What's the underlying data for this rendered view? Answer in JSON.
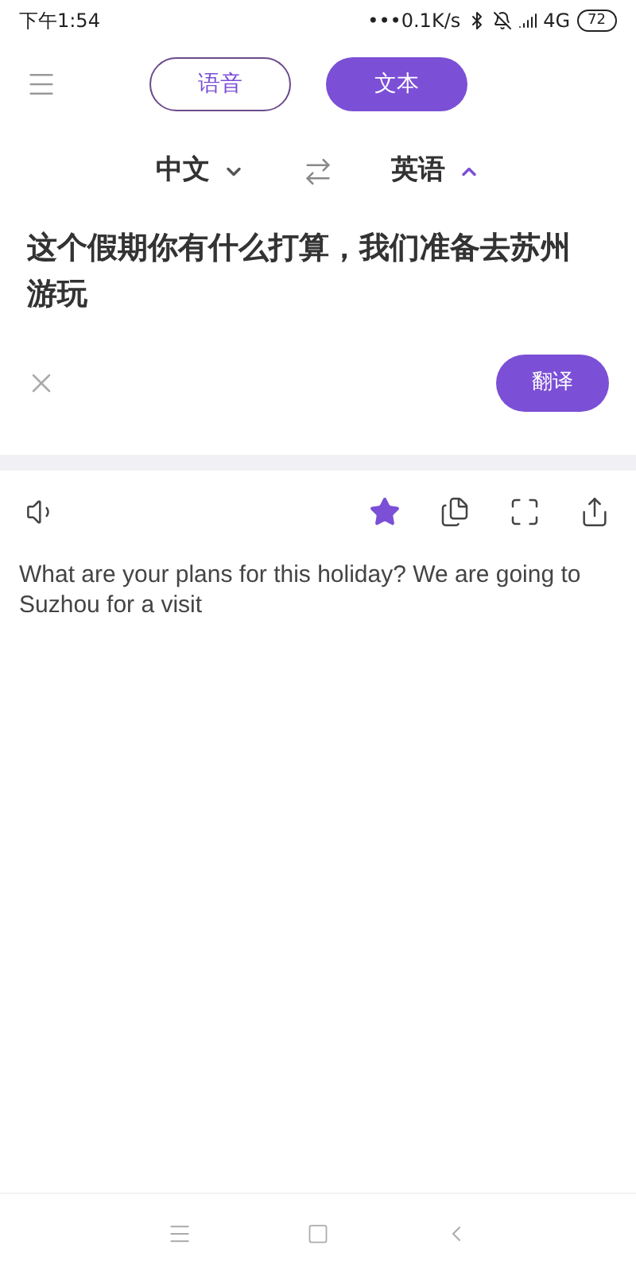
{
  "status_bar": {
    "time": "下午1:54",
    "speed": "•••0.1K/s",
    "network": "4G",
    "battery": "72"
  },
  "mode_tabs": [
    {
      "label": "语音",
      "selected": false
    },
    {
      "label": "文本",
      "selected": true
    }
  ],
  "languages": {
    "source": {
      "label": "中文",
      "expanded": false
    },
    "target": {
      "label": "英语",
      "expanded": true
    }
  },
  "input": {
    "value": "这个假期你有什么打算，我们准备去苏州游玩"
  },
  "translate_button": "翻译",
  "result": {
    "favorited": true,
    "text": "What are your plans for this holiday? We are going to Suzhou for a visit"
  }
}
